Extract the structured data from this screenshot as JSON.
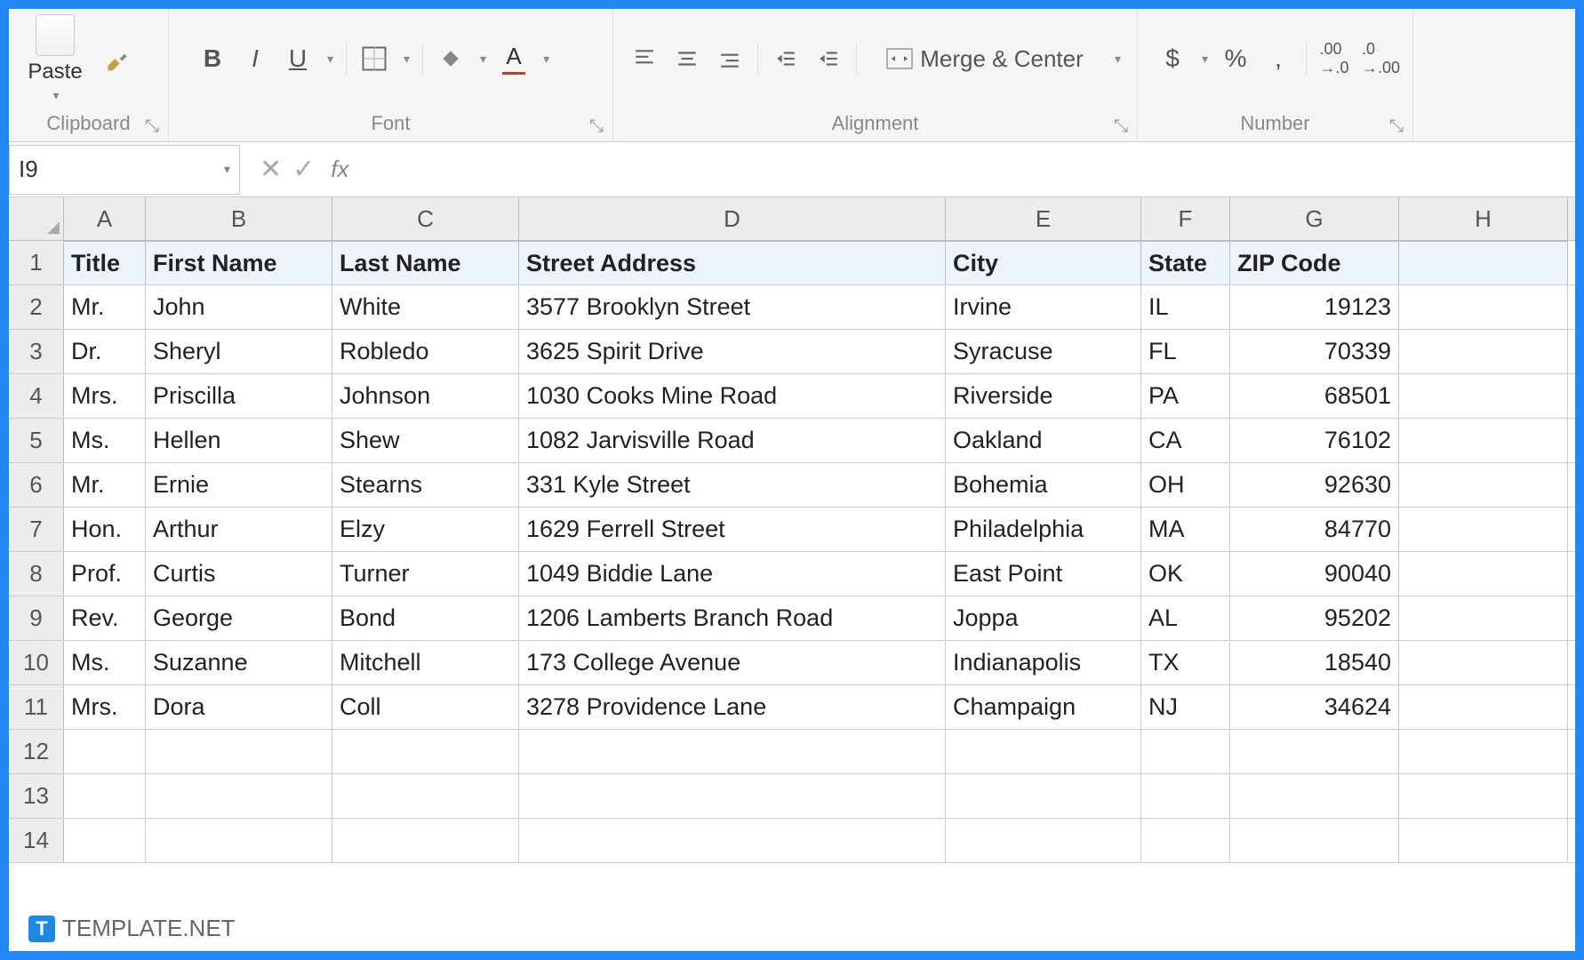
{
  "ribbon": {
    "clipboard": {
      "paste": "Paste",
      "label": "Clipboard"
    },
    "font": {
      "label": "Font"
    },
    "alignment": {
      "label": "Alignment",
      "merge": "Merge & Center"
    },
    "number": {
      "label": "Number",
      "currency": "$",
      "percent": "%",
      "comma": ","
    }
  },
  "name_box": "I9",
  "formula": "",
  "columns": [
    "A",
    "B",
    "C",
    "D",
    "E",
    "F",
    "G",
    "H"
  ],
  "headers": [
    "Title",
    "First Name",
    "Last Name",
    "Street Address",
    "City",
    "State",
    "ZIP Code"
  ],
  "rows": [
    {
      "n": 1,
      "cells": [
        "Title",
        "First Name",
        "Last Name",
        "Street Address",
        "City",
        "State",
        "ZIP Code",
        ""
      ]
    },
    {
      "n": 2,
      "cells": [
        "Mr.",
        "John",
        "White",
        "3577 Brooklyn Street",
        "Irvine",
        "IL",
        "19123",
        ""
      ]
    },
    {
      "n": 3,
      "cells": [
        "Dr.",
        "Sheryl",
        "Robledo",
        "3625 Spirit Drive",
        "Syracuse",
        "FL",
        "70339",
        ""
      ]
    },
    {
      "n": 4,
      "cells": [
        "Mrs.",
        "Priscilla",
        "Johnson",
        "1030 Cooks Mine Road",
        "Riverside",
        "PA",
        "68501",
        ""
      ]
    },
    {
      "n": 5,
      "cells": [
        "Ms.",
        "Hellen",
        "Shew",
        "1082 Jarvisville Road",
        "Oakland",
        "CA",
        "76102",
        ""
      ]
    },
    {
      "n": 6,
      "cells": [
        "Mr.",
        "Ernie",
        "Stearns",
        "331 Kyle Street",
        "Bohemia",
        "OH",
        "92630",
        ""
      ]
    },
    {
      "n": 7,
      "cells": [
        "Hon.",
        "Arthur",
        "Elzy",
        "1629 Ferrell Street",
        "Philadelphia",
        "MA",
        "84770",
        ""
      ]
    },
    {
      "n": 8,
      "cells": [
        "Prof.",
        "Curtis",
        "Turner",
        "1049 Biddie Lane",
        "East Point",
        "OK",
        "90040",
        ""
      ]
    },
    {
      "n": 9,
      "cells": [
        "Rev.",
        "George",
        "Bond",
        "1206 Lamberts Branch Road",
        "Joppa",
        "AL",
        "95202",
        ""
      ]
    },
    {
      "n": 10,
      "cells": [
        "Ms.",
        "Suzanne",
        "Mitchell",
        "173 College Avenue",
        "Indianapolis",
        "TX",
        "18540",
        ""
      ]
    },
    {
      "n": 11,
      "cells": [
        "Mrs.",
        "Dora",
        "Coll",
        "3278 Providence Lane",
        "Champaign",
        "NJ",
        "34624",
        ""
      ]
    },
    {
      "n": 12,
      "cells": [
        "",
        "",
        "",
        "",
        "",
        "",
        "",
        ""
      ]
    },
    {
      "n": 13,
      "cells": [
        "",
        "",
        "",
        "",
        "",
        "",
        "",
        ""
      ]
    },
    {
      "n": 14,
      "cells": [
        "",
        "",
        "",
        "",
        "",
        "",
        "",
        ""
      ]
    }
  ],
  "watermark": "TEMPLATE.NET"
}
